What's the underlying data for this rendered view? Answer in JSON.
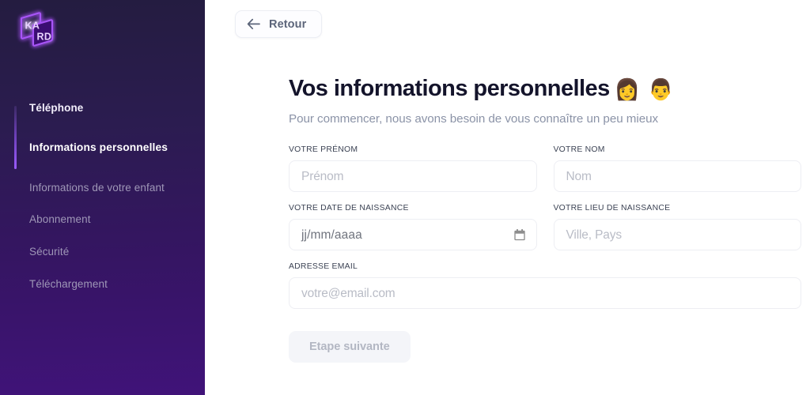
{
  "brand": {
    "logo_text_top": "KA",
    "logo_text_bottom": "RD",
    "logo_color": "#a855f7"
  },
  "sidebar": {
    "items": [
      {
        "label": "Téléphone",
        "state": "done"
      },
      {
        "label": "Informations personnelles",
        "state": "active"
      },
      {
        "label": "Informations de votre enfant",
        "state": "inactive"
      },
      {
        "label": "Abonnement",
        "state": "inactive"
      },
      {
        "label": "Sécurité",
        "state": "inactive"
      },
      {
        "label": "Téléchargement",
        "state": "inactive"
      }
    ],
    "indicator_color": "#9b5cff",
    "background_top": "#241c40",
    "background_bottom": "#401379"
  },
  "header": {
    "back_label": "Retour",
    "back_icon": "arrow-left-icon"
  },
  "main": {
    "title": "Vos informations personnelles",
    "title_emoji_1": "👩",
    "title_emoji_2": "👨",
    "subtitle": "Pour commencer, nous avons besoin de vous connaître un peu mieux"
  },
  "form": {
    "fields": [
      {
        "label": "VOTRE PRÉNOM",
        "placeholder": "Prénom",
        "value": "",
        "type": "text"
      },
      {
        "label": "VOTRE NOM",
        "placeholder": "Nom",
        "value": "",
        "type": "text"
      },
      {
        "label": "VOTRE DATE DE NAISSANCE",
        "placeholder": "jj/mm/aaaa",
        "value": "",
        "type": "date"
      },
      {
        "label": "VOTRE LIEU DE NAISSANCE",
        "placeholder": "Ville, Pays",
        "value": "",
        "type": "text"
      },
      {
        "label": "ADRESSE EMAIL",
        "placeholder": "votre@email.com",
        "value": "",
        "type": "email"
      }
    ],
    "submit_label": "Etape suivante",
    "submit_disabled": true
  }
}
